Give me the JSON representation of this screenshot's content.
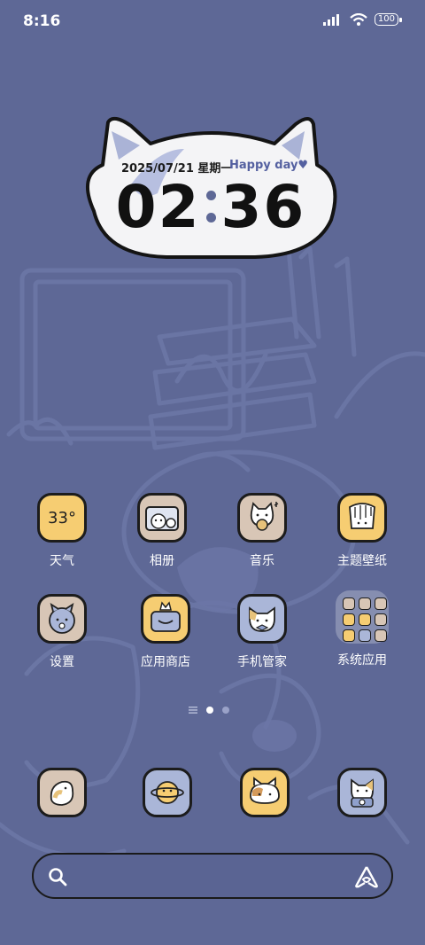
{
  "status": {
    "time": "8:16",
    "battery": "100"
  },
  "widget": {
    "date": "2025/07/21 星期一",
    "greeting": "Happy day♥",
    "hour": "02",
    "minute": "36"
  },
  "weather": {
    "temp": "33°"
  },
  "apps_row1": [
    {
      "label": "天气",
      "icon": "weather-icon"
    },
    {
      "label": "相册",
      "icon": "gallery-cat-icon"
    },
    {
      "label": "音乐",
      "icon": "music-cat-icon"
    },
    {
      "label": "主题壁纸",
      "icon": "themes-cat-icon"
    }
  ],
  "apps_row2": [
    {
      "label": "设置",
      "icon": "settings-cat-icon"
    },
    {
      "label": "应用商店",
      "icon": "app-store-cat-icon"
    },
    {
      "label": "手机管家",
      "icon": "security-cat-icon"
    },
    {
      "label": "系统应用",
      "icon": "system-folder-icon"
    }
  ],
  "dock": [
    "phone-cat-icon",
    "browser-planet-icon",
    "messages-cat-icon",
    "camera-cat-icon"
  ],
  "colors": {
    "background": "#5e6896",
    "icon_yellow": "#f6cd72",
    "icon_beige": "#d8c6b6",
    "icon_blue": "#aab6d8"
  }
}
